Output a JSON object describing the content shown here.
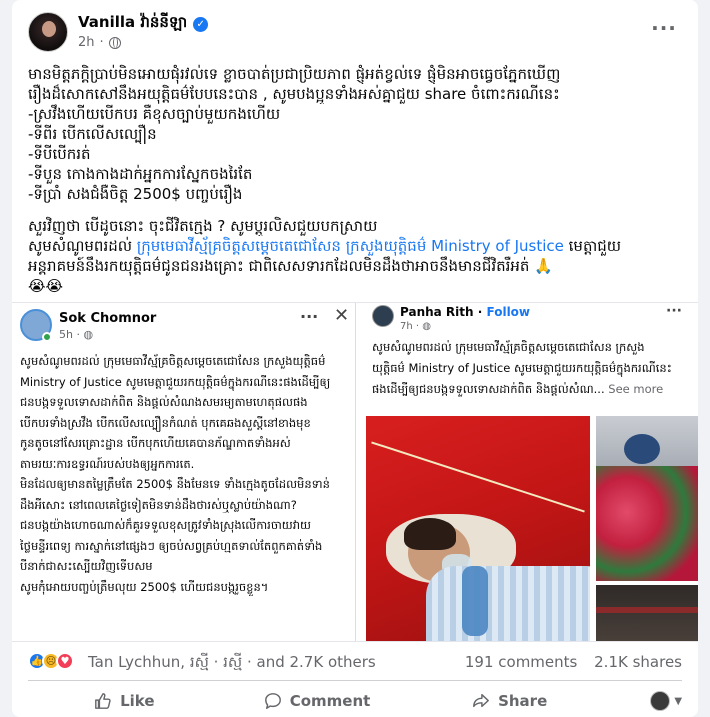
{
  "post": {
    "author": "Vanilla វ៉ាន់នីឡា",
    "time": "2h",
    "lines": [
      "មានមិត្តភក្តិប្រាប់មិនអោយផុំរវល់ទេ ខ្លាចបាត់ប្រជាប្រិយភាព ផ្ញុំអត់ខ្វល់ទេ ផ្ញុំមិនអាចធ្វេចភ្នែកឃើញ",
      "រឿងដ៏សោកសៅនឹងអយុត្តិធម៌បែបនេះបាន , សូមបងប្អូនទាំងអស់គ្នាជួយ share ចំពោះករណីនេះ",
      "-ស្រវឹងហើយបើកបរ គឺខុសច្បាប់មួយកងហើយ",
      "-ទីពីរ បើកលើសល្បឿន",
      "-ទីបីបើករត់",
      "-ទីបួន កោងកាងដាក់អ្នកការស្នែកចងរៃតែ",
      "-ទីប្រាំ សងជំងឺចិត្ត 2500$ បញ្ចប់រឿង"
    ],
    "line8": "សួរវិញថា បើដូចនោះ ចុះជីវិតក្មេង ? សូមប្ដូរលិសជួយបកស្រាយ",
    "line9_prefix": "សូមសំណូមពរដល់ ",
    "line9_link1": "ក្រុមមេធាវីស្ម័គ្រចិត្តសម្ដេចតេជោសែន",
    "line9_space": " ",
    "line9_link2": "ក្រសួងយុត្តិធម៌ Ministry of Justice",
    "line9_suffix": " មេត្តាជួយ",
    "line10": "អន្តរាគមន៍នឹងរកយុត្តិធម៌ជូនជនរងគ្រោះ ជាពិសេសទារកដែលមិនដឹងថាអាចនឹងមានជីវិតរឺអត់ 🙏",
    "line11": "😭😭"
  },
  "media": {
    "left": {
      "name": "Sok Chomnor",
      "time": "5h",
      "lines": [
        "សូមសំណូមពរដល់ ក្រុមមេធាវីស្ម័គ្រចិត្តសម្ដេចតេជោសែន ក្រសួងយុត្តិធម៌",
        "Ministry of Justice សូមមេត្តាជួយរកយុត្តិធម៌ក្នុងករណីនេះផងដើម្បីឲ្យ",
        "ជនបង្កទទួលទោសដាក់ពិត និងផ្ដល់សំណងសមរម្យតាមហេតុផលផង",
        "បើកបរទាំងស្រវឹង បើកលើសល្បឿនកំណត់ បុកគេឆងសួស្ដីនៅខាងមុខ",
        "កូនតូចនៅសែរគ្រោះដ្ឋាន បើកបុកហើយគេបានភ័ណ្ឌកាតទាំងអស់",
        "តាមរយៈការឧទ្ធរណ៍របស់បងឲ្យអ្នកការតេ.",
        "មិនដែលឲ្យមានតម្លៃត្រឹមតែ 2500$ នឹងមែនទេ ទាំងក្មេងតូចដែលមិនទាន់",
        "ដឹងអីសោះ នៅពេលគេថ្ងៃទៀតមិនទាន់ដឹងថារស់ឬស្លាប់យ៉ាងណា?",
        "ជនបង្កយ៉ាងហោចណាស់ក៏គួរទទួលខុសត្រូវទាំងស្រុងលើការចាយវាយ",
        "ថ្លៃមន្ទីរពេទ្យ ការស្នាក់នៅផ្សេងៗ ឲ្យចប់សព្វគ្រប់ហ្មតទាល់តែពួកគាត់ទាំង",
        "បីនាក់ជាសះស្បើយវិញទើបសម",
        "សូមកុំអោយបញ្ចប់ត្រឹមលុយ 2500$ ហើយជនបង្ករួចខ្លួន។"
      ]
    },
    "right": {
      "name": "Panha Rith",
      "follow": "Follow",
      "time": "7h",
      "lines": [
        "សូមសំណូមពរដល់ ក្រុមមេធាវីស្ម័គ្រចិត្តសម្ដេចតេជោសែន ក្រសួង",
        "យុត្តិធម៌ Ministry of Justice សូមមេត្តាជួយរកយុត្តិធម៌ក្នុងករណីនេះ",
        "ផងដើម្បីឲ្យជនបង្កទទួលទោសដាក់ពិត និងផ្ដល់សំណ..."
      ],
      "see_more": "See more"
    }
  },
  "stats": {
    "reactors": "Tan Lychhun, រស្មី · រស្មី · and 2.7K others",
    "comments": "191 comments",
    "shares": "2.1K shares"
  },
  "actions": {
    "like": "Like",
    "comment": "Comment",
    "share": "Share"
  },
  "colors": {
    "accent": "#1877f2",
    "secondary_text": "#65676b"
  }
}
